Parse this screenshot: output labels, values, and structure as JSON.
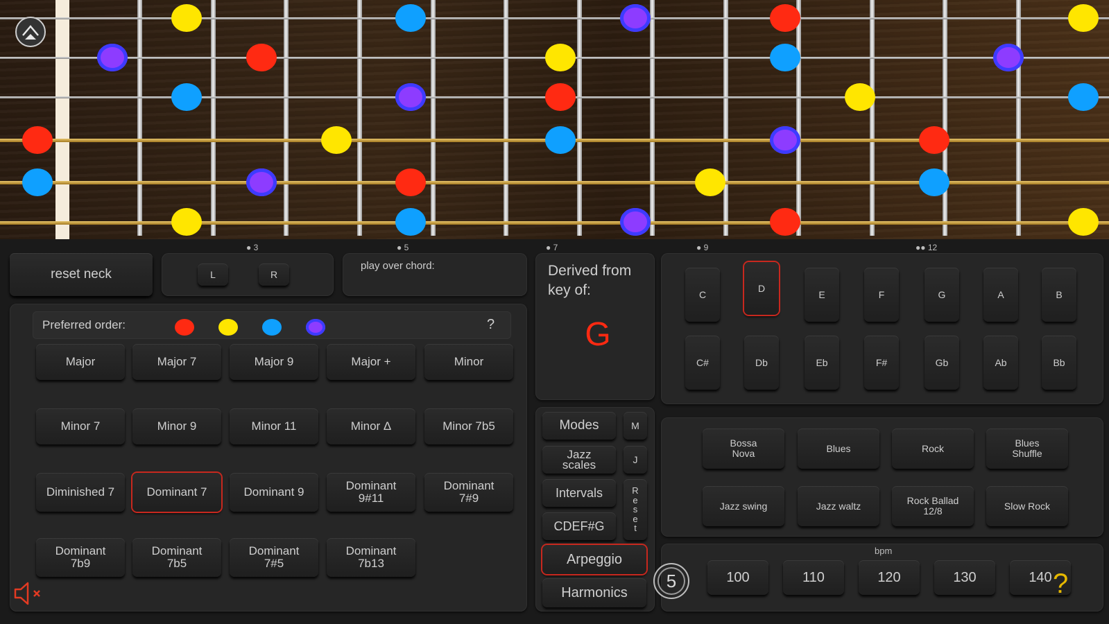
{
  "fretboard": {
    "markers": [
      "3",
      "5",
      "7",
      "9",
      "12"
    ],
    "dots": [
      {
        "string": 1,
        "color": "yellow"
      },
      {
        "string": 1,
        "color": "blue"
      },
      {
        "string": 1,
        "color": "purple"
      },
      {
        "string": 1,
        "color": "red"
      },
      {
        "string": 1,
        "color": "yellow"
      }
    ]
  },
  "controls": {
    "reset_neck": "reset neck",
    "left": "L",
    "right": "R",
    "play_over_chord": "play over chord:"
  },
  "chords": {
    "preferred_order_label": "Preferred order:",
    "help": "?",
    "preferred_colors": [
      "#ff2a12",
      "#ffe600",
      "#0fa0ff",
      "#8d3cff"
    ],
    "row1": [
      "Major",
      "Major 7",
      "Major 9",
      "Major +",
      "Minor"
    ],
    "row2": [
      "Minor 7",
      "Minor 9",
      "Minor 11",
      "Minor Δ",
      "Minor 7b5"
    ],
    "row3": [
      "Diminished 7",
      "Dominant 7",
      "Dominant 9",
      "Dominant 9#11",
      "Dominant 7#9"
    ],
    "row4": [
      "Dominant 7b9",
      "Dominant 7b5",
      "Dominant 7#5",
      "Dominant 7b13"
    ],
    "selected": "Dominant 7"
  },
  "key": {
    "derived_label": "Derived from key of:",
    "value": "G",
    "naturals": [
      "C",
      "D",
      "E",
      "F",
      "G",
      "A",
      "B"
    ],
    "accidentals": [
      "C#",
      "Db",
      "Eb",
      "F#",
      "Gb",
      "Ab",
      "Bb"
    ],
    "selected": "D"
  },
  "modes": {
    "modes": "Modes",
    "m": "M",
    "jazz_scales": "Jazz scales",
    "j": "J",
    "intervals": "Intervals",
    "reset": "Reset",
    "cdefg": "CDEF#G",
    "arpeggio": "Arpeggio",
    "harmonics": "Harmonics",
    "selected": "Arpeggio"
  },
  "rhythms": {
    "row1": [
      "Bossa Nova",
      "Blues",
      "Rock",
      "Blues Shuffle"
    ],
    "row2": [
      "Jazz swing",
      "Jazz waltz",
      "Rock Ballad 12/8",
      "Slow Rock"
    ]
  },
  "tempo": {
    "label": "bpm",
    "values": [
      "100",
      "110",
      "120",
      "130",
      "140"
    ],
    "metronome": "5",
    "help": "?"
  },
  "colors": {
    "red": "#ff2a12",
    "yellow": "#ffe600",
    "blue": "#0fa0ff",
    "purple": "#8d3cff",
    "accent": "#c8281e"
  }
}
